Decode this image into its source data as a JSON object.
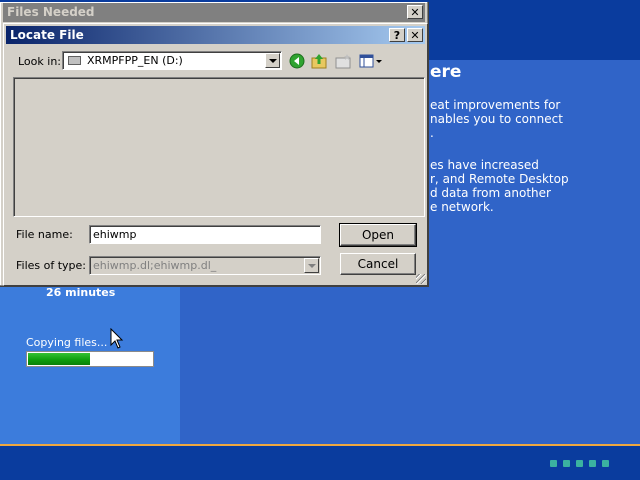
{
  "setup": {
    "heading": "ere",
    "para1": "eat improvements for\nnables you to connect\n.",
    "para2": "es have increased\nr, and Remote Desktop\nd data from another\ne network.",
    "time_left": "26 minutes",
    "status": "Copying files...",
    "progress": 0.5
  },
  "files_needed": {
    "title": "Files Needed",
    "close_label": "✕"
  },
  "locate_file": {
    "title": "Locate File",
    "help_label": "?",
    "close_label": "✕",
    "look_in_label": "Look in:",
    "look_in_value": "XRMPFPP_EN (D:)",
    "file_name_label": "File name:",
    "file_name_value": "ehiwmp",
    "files_of_type_label": "Files of type:",
    "files_of_type_value": "ehiwmp.dl;ehiwmp.dl_",
    "open_label": "Open",
    "cancel_label": "Cancel",
    "toolbar_icons": [
      "back-icon",
      "up-folder-icon",
      "new-folder-icon",
      "view-menu-icon"
    ]
  }
}
